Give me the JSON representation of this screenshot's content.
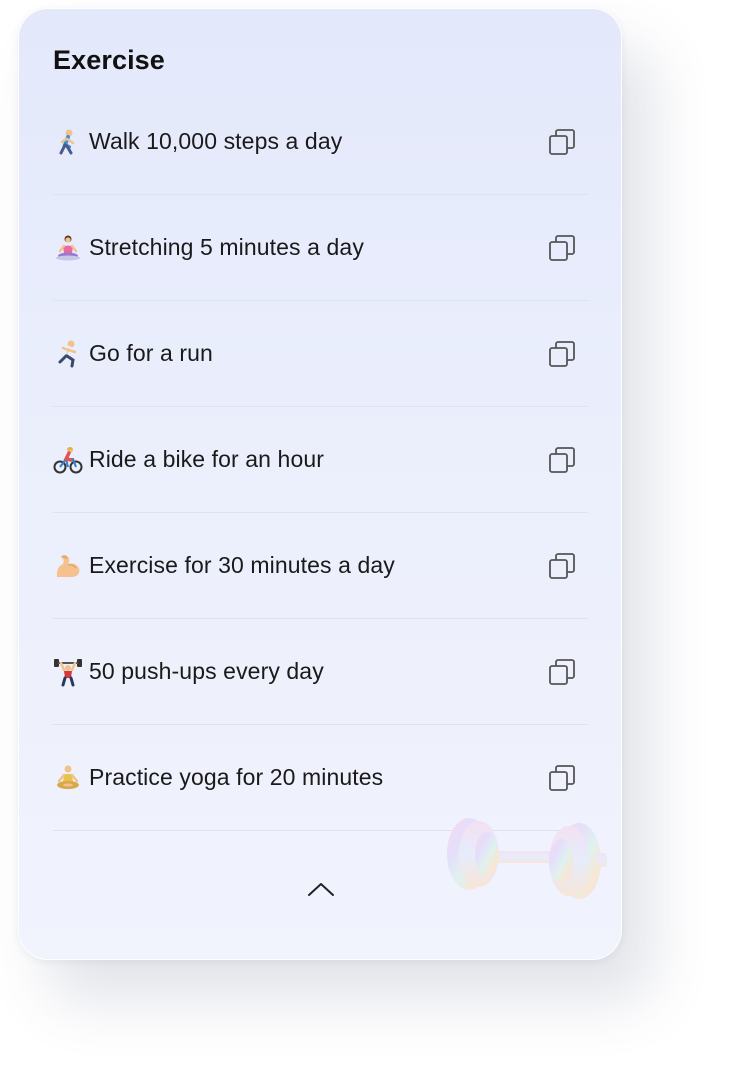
{
  "card": {
    "title": "Exercise",
    "items": [
      {
        "icon": "person-walking-icon",
        "label": "Walk 10,000 steps a day"
      },
      {
        "icon": "person-stretching-icon",
        "label": "Stretching 5 minutes a day"
      },
      {
        "icon": "person-running-icon",
        "label": "Go for a run"
      },
      {
        "icon": "person-biking-icon",
        "label": "Ride a bike for an hour"
      },
      {
        "icon": "flexed-biceps-icon",
        "label": "Exercise for 30 minutes a day"
      },
      {
        "icon": "person-lifting-weights-icon",
        "label": "50 push-ups every day"
      },
      {
        "icon": "person-yoga-icon",
        "label": "Practice yoga for 20 minutes"
      }
    ],
    "copy_icon": "copy-icon",
    "collapse_icon": "chevron-up-icon",
    "decoration_icon": "dumbbell-icon"
  },
  "colors": {
    "card_background": "#e8ecfb",
    "text": "#1a1a1a",
    "divider": "#dde1f0",
    "icon_stroke": "#555555"
  }
}
